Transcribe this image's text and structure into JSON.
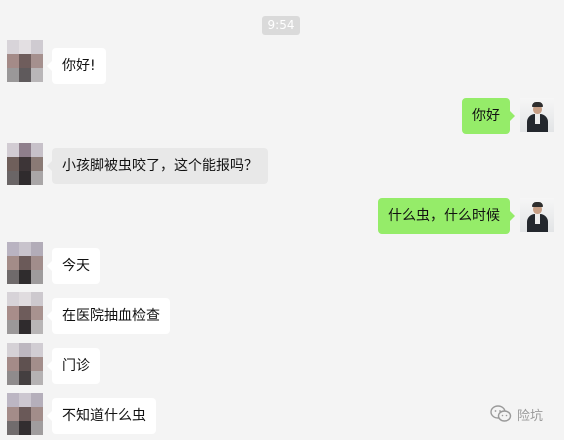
{
  "chat": {
    "timestamp": "9:54",
    "messages": [
      {
        "side": "left",
        "text": "你好!"
      },
      {
        "side": "right",
        "text": "你好"
      },
      {
        "side": "left",
        "text": "小孩脚被虫咬了，这个能报吗？"
      },
      {
        "side": "right",
        "text": "什么虫，什么时候"
      },
      {
        "side": "left",
        "text": "今天"
      },
      {
        "side": "left",
        "text": "在医院抽血检查"
      },
      {
        "side": "left",
        "text": "门诊"
      },
      {
        "side": "left",
        "text": "不知道什么虫"
      }
    ]
  },
  "watermark": {
    "icon": "wechat-icon",
    "text": "险坑"
  },
  "colors": {
    "background": "#f4f4f4",
    "incoming_bubble": "#ffffff",
    "incoming_bubble_selected": "#e8e8e8",
    "outgoing_bubble": "#95ec69",
    "timestamp_pill": "#dadada"
  }
}
